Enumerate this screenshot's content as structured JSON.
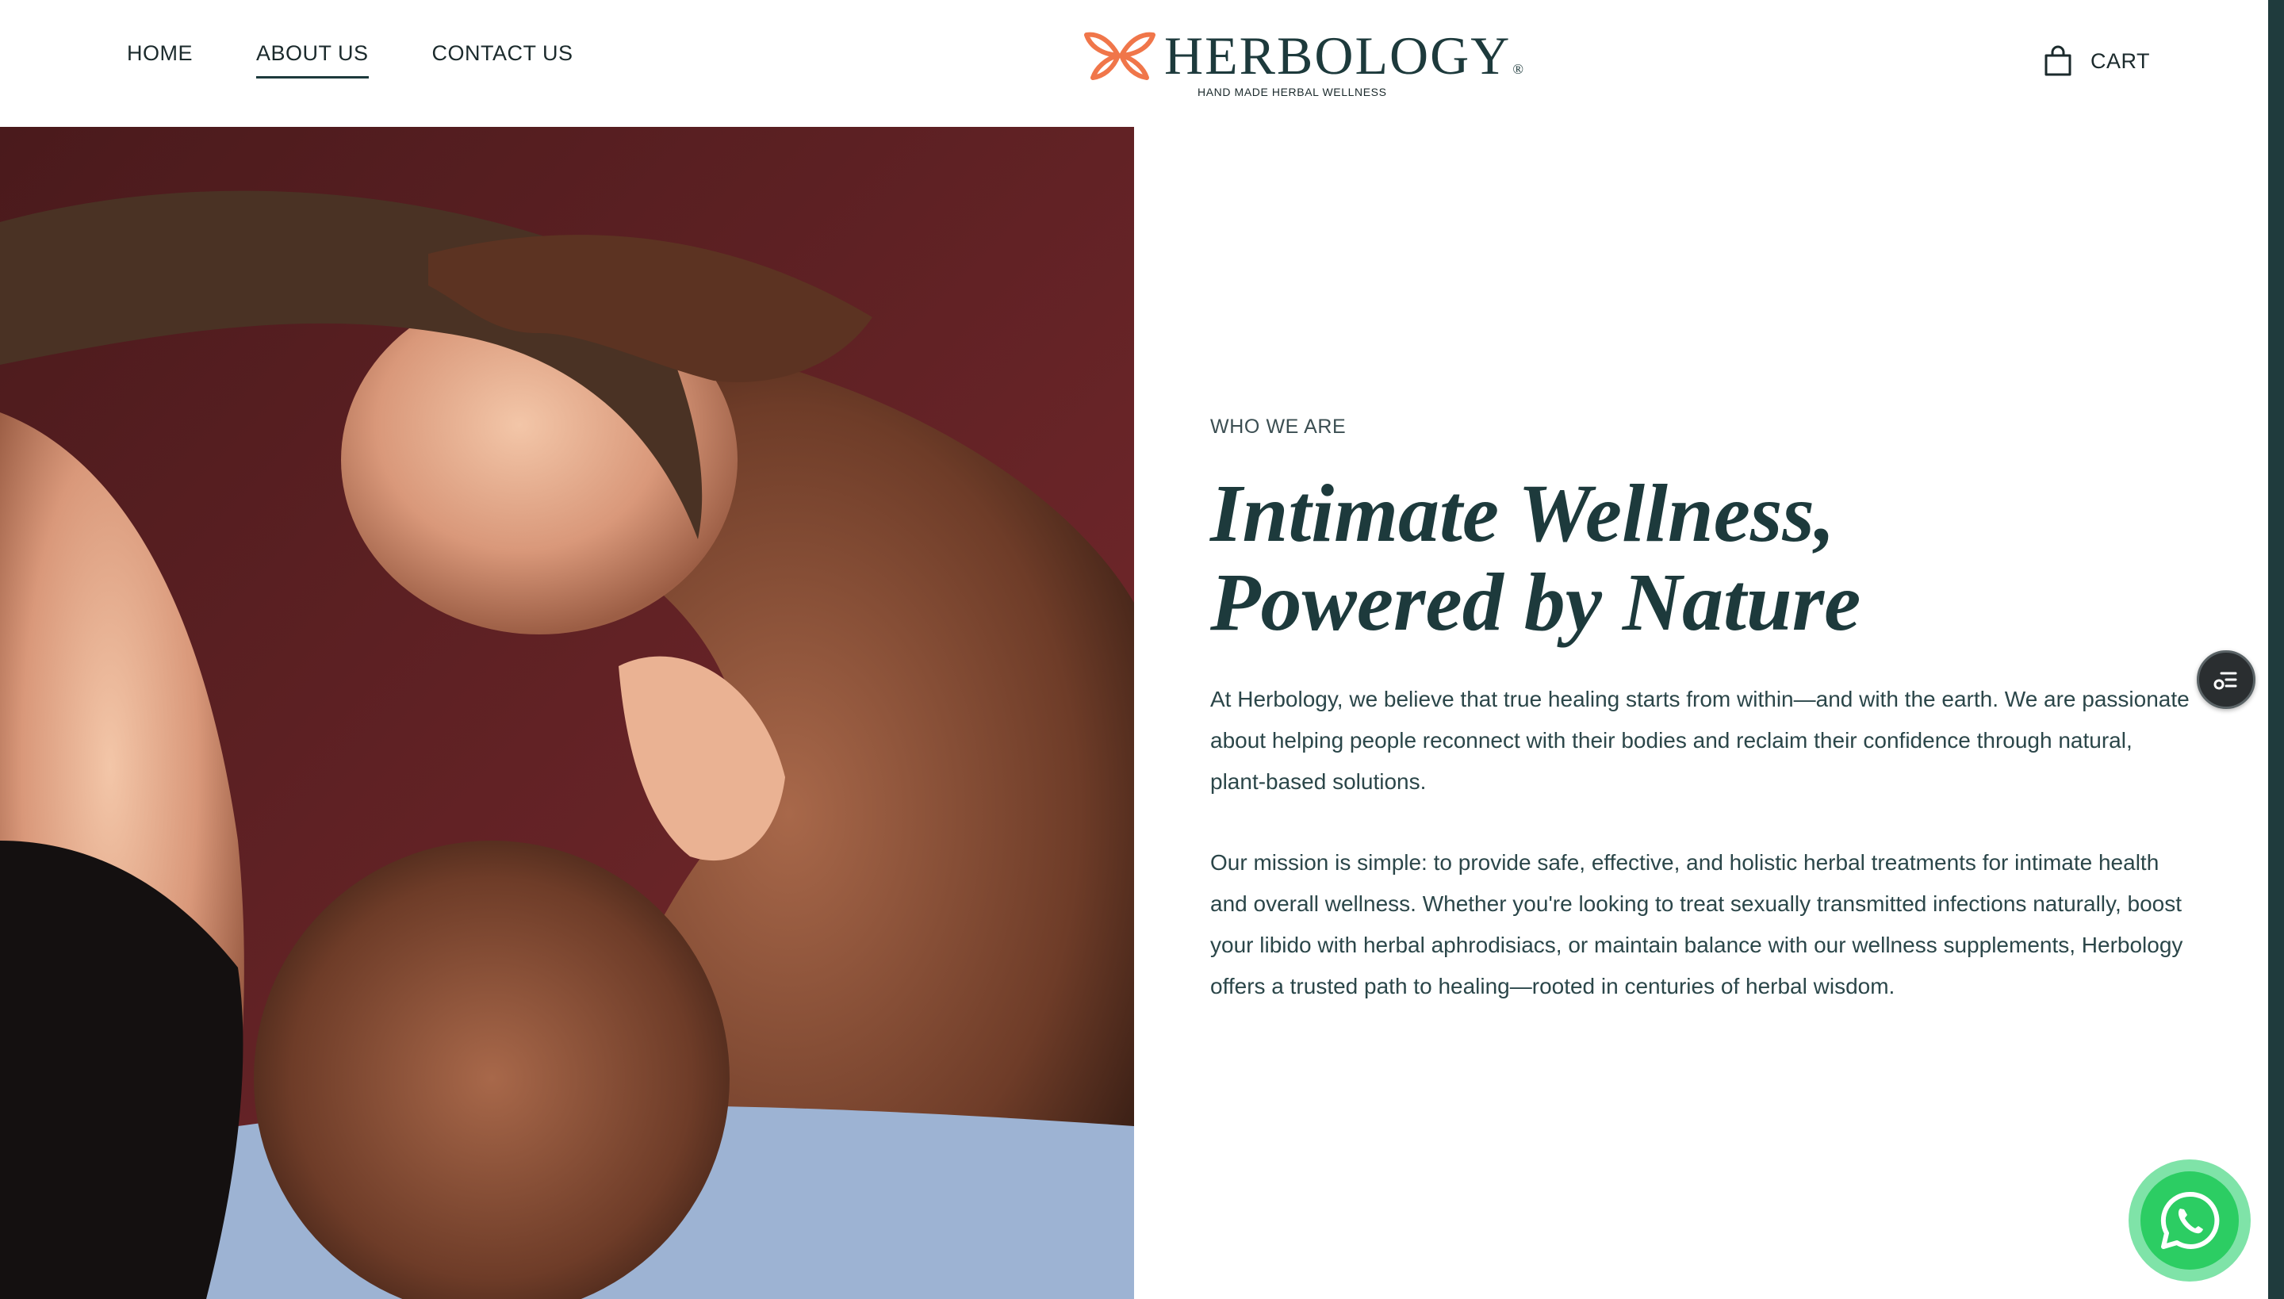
{
  "nav": {
    "items": [
      {
        "label": "HOME",
        "active": false
      },
      {
        "label": "ABOUT US",
        "active": true
      },
      {
        "label": "CONTACT US",
        "active": false
      }
    ]
  },
  "brand": {
    "name": "HERBOLOGY",
    "registered_mark": "®",
    "tagline": "HAND MADE HERBAL WELLNESS",
    "logo_icon": "butterfly-leaf-icon"
  },
  "cart": {
    "label": "CART",
    "icon": "shopping-bag-icon"
  },
  "hero_image": {
    "alt": "Couple embracing"
  },
  "section": {
    "eyebrow": "WHO WE ARE",
    "headline_line1": "Intimate Wellness,",
    "headline_line2": "Powered by Nature",
    "paragraph1": "At Herbology, we believe that true healing starts from within—and with the earth. We are passionate about helping people reconnect with their bodies and reclaim their confidence through natural, plant-based solutions.",
    "paragraph2": "Our mission is simple: to provide safe, effective, and holistic herbal treatments for intimate health and overall wellness. Whether you're looking to treat sexually transmitted infections naturally, boost your libido with herbal aphrodisiacs, or maintain balance with our wellness supplements, Herbology offers a trusted path to healing—rooted in centuries of herbal wisdom."
  },
  "floating": {
    "accessibility_icon": "accessibility-menu-icon",
    "whatsapp_icon": "whatsapp-icon"
  },
  "colors": {
    "brand_dark": "#1d3a3c",
    "brand_orange": "#f0764a",
    "whatsapp_green": "#2ccd63"
  }
}
